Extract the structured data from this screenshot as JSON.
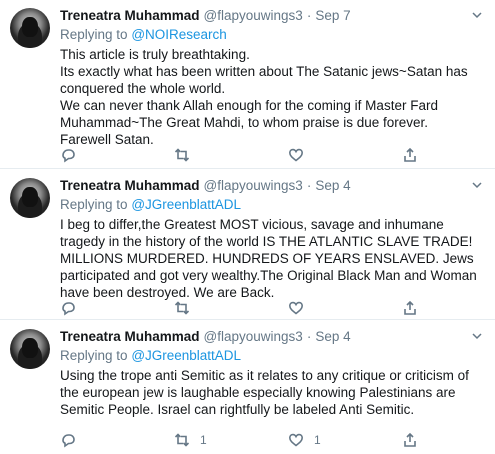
{
  "tweets": [
    {
      "name": "Treneatra Muhammad",
      "handle": "@flapyouwings3",
      "separator": "·",
      "date": "Sep 7",
      "replying_prefix": "Replying to",
      "replying_to": "@NOIResearch",
      "lines": [
        "This article is truly breathtaking.",
        "Its exactly what has been written about The Satanic jews~Satan has conquered the whole world.",
        "We can never thank Allah enough for the coming if Master Fard Muhammad~The Great Mahdi, to whom praise is due forever.",
        "Farewell Satan."
      ],
      "actions": {
        "reply_count": "",
        "retweet_count": "",
        "like_count": ""
      }
    },
    {
      "name": "Treneatra Muhammad",
      "handle": "@flapyouwings3",
      "separator": "·",
      "date": "Sep 4",
      "replying_prefix": "Replying to",
      "replying_to": "@JGreenblattADL",
      "lines": [
        "I beg to differ,the Greatest MOST vicious, savage and inhumane tragedy in the history of the world IS THE ATLANTIC SLAVE TRADE! MILLIONS MURDERED. HUNDREDS OF YEARS ENSLAVED. Jews participated and got very wealthy.The Original Black Man and Woman have been destroyed. We are Back."
      ],
      "actions": {
        "reply_count": "",
        "retweet_count": "",
        "like_count": ""
      }
    },
    {
      "name": "Treneatra Muhammad",
      "handle": "@flapyouwings3",
      "separator": "·",
      "date": "Sep 4",
      "replying_prefix": "Replying to",
      "replying_to": "@JGreenblattADL",
      "lines": [
        "Using the trope anti Semitic as it relates to any critique or criticism of the european jew is laughable especially knowing Palestinians are Semitic People. Israel can rightfully be labeled Anti Semitic."
      ],
      "actions": {
        "reply_count": "",
        "retweet_count": "1",
        "like_count": "1"
      }
    }
  ],
  "icons": {
    "reply": "reply-icon",
    "retweet": "retweet-icon",
    "like": "heart-icon",
    "share": "share-icon",
    "caret": "chevron-down-icon"
  },
  "colors": {
    "link": "#1b95e0",
    "secondary_text": "#657786",
    "divider": "#e6ecf0"
  }
}
